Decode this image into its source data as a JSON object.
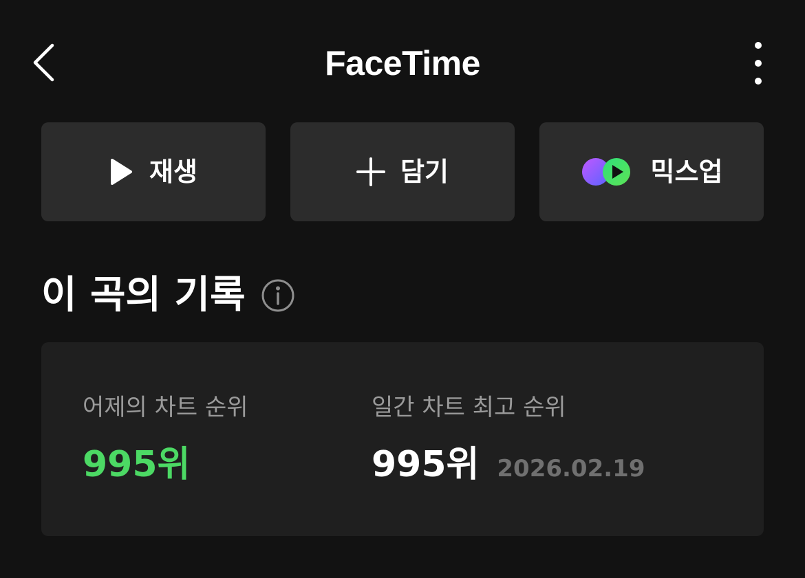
{
  "header": {
    "title": "FaceTime",
    "back_icon": "chevron-left-icon",
    "more_icon": "more-vertical-icon"
  },
  "actions": {
    "play": {
      "label": "재생",
      "icon": "play-icon"
    },
    "add": {
      "label": "담기",
      "icon": "plus-icon"
    },
    "mixup": {
      "label": "믹스업",
      "icon": "mixup-icon"
    }
  },
  "section": {
    "title": "이 곡의 기록",
    "info_icon": "info-icon"
  },
  "stats": {
    "yesterday": {
      "label": "어제의 차트 순위",
      "value": "995위"
    },
    "daily_best": {
      "label": "일간 차트 최고 순위",
      "value": "995위",
      "date": "2026.02.19"
    }
  },
  "colors": {
    "background": "#121212",
    "button_bg": "#2c2c2c",
    "card_bg": "#1f1f1f",
    "accent_green": "#4cd964",
    "label_gray": "#9a9a9a",
    "date_gray": "#707070"
  }
}
